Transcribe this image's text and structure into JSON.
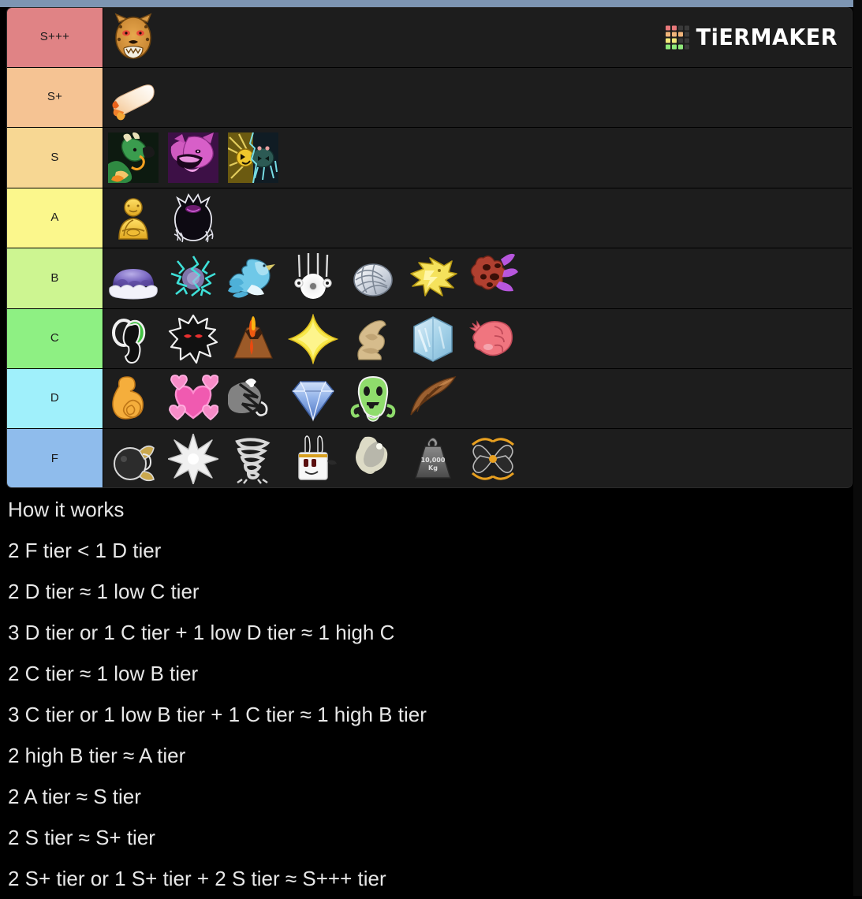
{
  "watermark": {
    "brand": "TiERMAKER",
    "grid_colors": [
      [
        "#e8797b",
        "#e8797b",
        "#3a3a3a",
        "#3a3a3a"
      ],
      [
        "#f0b47a",
        "#f0b47a",
        "#f0b47a",
        "#3a3a3a"
      ],
      [
        "#f0e87a",
        "#f0e87a",
        "#3a3a3a",
        "#3a3a3a"
      ],
      [
        "#8ee87a",
        "#8ee87a",
        "#8ee87a",
        "#3a3a3a"
      ]
    ]
  },
  "tiers": [
    {
      "label": "S+++",
      "color": "#e08385",
      "items": [
        {
          "name": "leopard-fruit",
          "icon": "leopard"
        }
      ]
    },
    {
      "label": "S+",
      "color": "#f5c393",
      "items": [
        {
          "name": "dough-fruit",
          "icon": "dough"
        }
      ]
    },
    {
      "label": "S",
      "color": "#f7d793",
      "items": [
        {
          "name": "dragon-fruit",
          "icon": "green-dragon"
        },
        {
          "name": "venom-fruit",
          "icon": "purple-dragon"
        },
        {
          "name": "rumble-fruit",
          "icon": "sun-lightning"
        }
      ]
    },
    {
      "label": "A",
      "color": "#fbf78c",
      "items": [
        {
          "name": "buddha-fruit",
          "icon": "buddha"
        },
        {
          "name": "shadow-fruit",
          "icon": "shadow"
        }
      ]
    },
    {
      "label": "B",
      "color": "#cdf591",
      "items": [
        {
          "name": "gas-fruit",
          "icon": "gas-cloud"
        },
        {
          "name": "control-fruit",
          "icon": "electric-orb"
        },
        {
          "name": "phoenix-fruit",
          "icon": "blue-phoenix"
        },
        {
          "name": "spirit-fruit",
          "icon": "spirit-orb"
        },
        {
          "name": "string-fruit",
          "icon": "string-ball"
        },
        {
          "name": "dough-lightning-fruit",
          "icon": "yellow-bolt"
        },
        {
          "name": "magma-meteor-fruit",
          "icon": "meteor"
        }
      ]
    },
    {
      "label": "C",
      "color": "#8ef083",
      "items": [
        {
          "name": "portal-fruit",
          "icon": "portal"
        },
        {
          "name": "dark-fruit",
          "icon": "dark-blob"
        },
        {
          "name": "magma-fruit",
          "icon": "volcano"
        },
        {
          "name": "light-fruit",
          "icon": "yellow-star"
        },
        {
          "name": "sand-fruit",
          "icon": "sand"
        },
        {
          "name": "ice-fruit",
          "icon": "ice-cube"
        },
        {
          "name": "rubber-fruit",
          "icon": "pink-fist"
        }
      ]
    },
    {
      "label": "D",
      "color": "#a0f0fb",
      "items": [
        {
          "name": "spring-fruit",
          "icon": "orange-spring"
        },
        {
          "name": "love-fruit",
          "icon": "pink-hearts"
        },
        {
          "name": "spike-fruit",
          "icon": "smoke-spike"
        },
        {
          "name": "diamond-fruit",
          "icon": "blue-diamond"
        },
        {
          "name": "ghost-fruit",
          "icon": "green-ghost"
        },
        {
          "name": "falcon-fruit",
          "icon": "brown-wing"
        }
      ]
    },
    {
      "label": "F",
      "color": "#8fbcec",
      "items": [
        {
          "name": "bomb-fruit",
          "icon": "bomb"
        },
        {
          "name": "spike-star-fruit",
          "icon": "white-spike"
        },
        {
          "name": "spin-fruit",
          "icon": "tornado"
        },
        {
          "name": "barrier-fruit",
          "icon": "white-rabbit"
        },
        {
          "name": "smoke-fruit",
          "icon": "smoke"
        },
        {
          "name": "kilo-fruit",
          "icon": "weight",
          "label": "10,000 Kg"
        },
        {
          "name": "spin-blade-fruit",
          "icon": "dark-spin"
        }
      ]
    }
  ],
  "notes": {
    "heading": "How it works",
    "lines": [
      "2 F tier < 1 D tier",
      "2 D tier ≈ 1 low C tier",
      "3 D tier or 1 C tier + 1 low D tier ≈ 1 high C",
      "2 C tier ≈ 1 low B tier",
      "3 C tier or 1 low B tier + 1 C tier ≈ 1 high B tier",
      "2 high B tier ≈ A tier",
      "2 A tier ≈ S tier",
      "2 S tier ≈ S+ tier",
      "2 S+ tier or 1 S+ tier + 2 S tier ≈ S+++ tier"
    ]
  }
}
